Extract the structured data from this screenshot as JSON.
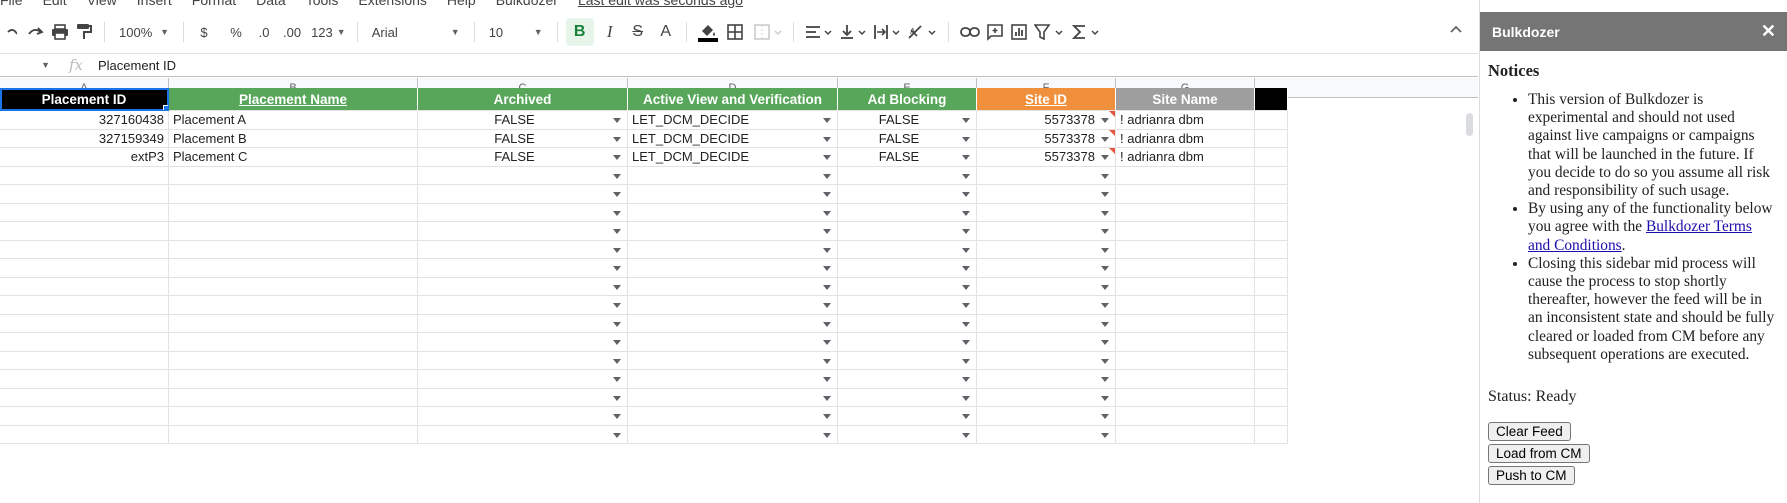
{
  "menu": {
    "items": [
      "File",
      "Edit",
      "View",
      "Insert",
      "Format",
      "Data",
      "Tools",
      "Extensions",
      "Help",
      "Bulkdozer"
    ],
    "last_edit": "Last edit was seconds ago"
  },
  "toolbar": {
    "zoom": "100%",
    "currency": "$",
    "percent": "%",
    "dec_decrease": ".0",
    "dec_increase": ".00",
    "number_format": "123",
    "font": "Arial",
    "font_size": "10",
    "bold": "B",
    "italic": "I",
    "strike": "S",
    "text_color": "A",
    "collapse": "^"
  },
  "formula_bar": {
    "fx": "fx",
    "value": "Placement ID"
  },
  "columns": [
    "A",
    "B",
    "C",
    "D",
    "E",
    "F",
    "G"
  ],
  "header_row": {
    "a": "Placement ID",
    "b": "Placement Name",
    "c": "Archived",
    "d": "Active View and Verification",
    "e": "Ad Blocking",
    "f": "Site ID",
    "g": "Site Name"
  },
  "colors": {
    "green_header": "#57a65a",
    "orange_header": "#f0903c",
    "gray_header": "#9e9e9e",
    "selection": "#1a73e8"
  },
  "rows": [
    {
      "id": "327160438",
      "name": "Placement A",
      "archived": "FALSE",
      "active_view": "LET_DCM_DECIDE",
      "ad_blocking": "FALSE",
      "site_id": "5573378",
      "site_name": "! adrianra dbm"
    },
    {
      "id": "327159349",
      "name": "Placement B",
      "archived": "FALSE",
      "active_view": "LET_DCM_DECIDE",
      "ad_blocking": "FALSE",
      "site_id": "5573378",
      "site_name": "! adrianra dbm"
    },
    {
      "id": "extP3",
      "name": "Placement C",
      "archived": "FALSE",
      "active_view": "LET_DCM_DECIDE",
      "ad_blocking": "FALSE",
      "site_id": "5573378",
      "site_name": "! adrianra dbm"
    }
  ],
  "sidebar": {
    "title": "Bulkdozer",
    "close": "✕",
    "notices_heading": "Notices",
    "notice1": "This version of Bulkdozer is experimental and should not used against live campaigns or campaigns that will be launched in the future. If you decide to do so you assume all risk and responsibility of such usage.",
    "notice2_pre": "By using any of the functionality below you agree with the ",
    "notice2_link": "Bulkdozer Terms and Conditions",
    "notice2_post": ".",
    "notice3": "Closing this sidebar mid process will cause the process to stop shortly thereafter, however the feed will be in an inconsistent state and should be fully cleared or loaded from CM before any subsequent operations are executed.",
    "status": "Status: Ready",
    "btn_clear": "Clear Feed",
    "btn_load": "Load from CM",
    "btn_push": "Push to CM"
  }
}
